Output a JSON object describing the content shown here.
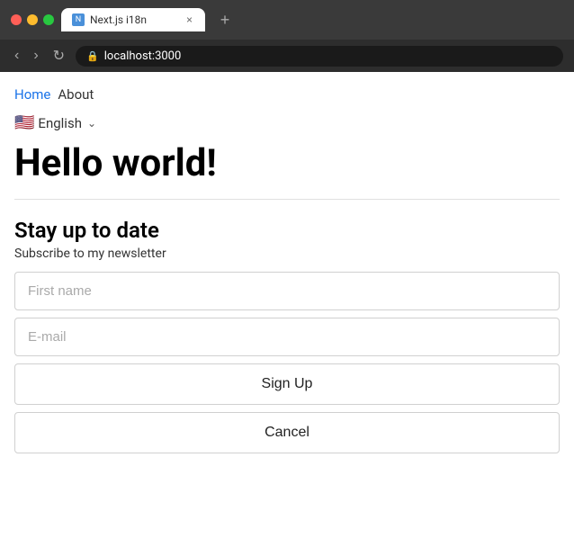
{
  "browser": {
    "tab_title": "Next.js i18n",
    "address": "localhost:3000",
    "tab_close_symbol": "×",
    "tab_new_symbol": "+",
    "nav_back": "‹",
    "nav_forward": "›",
    "nav_refresh": "↻"
  },
  "nav": {
    "home_label": "Home",
    "about_label": "About"
  },
  "language": {
    "flag": "🇺🇸",
    "label": "English",
    "chevron": "⌄"
  },
  "hero": {
    "heading": "Hello world!"
  },
  "newsletter": {
    "heading": "Stay up to date",
    "subtitle": "Subscribe to my newsletter",
    "first_name_placeholder": "First name",
    "email_placeholder": "E-mail",
    "signup_label": "Sign Up",
    "cancel_label": "Cancel"
  }
}
